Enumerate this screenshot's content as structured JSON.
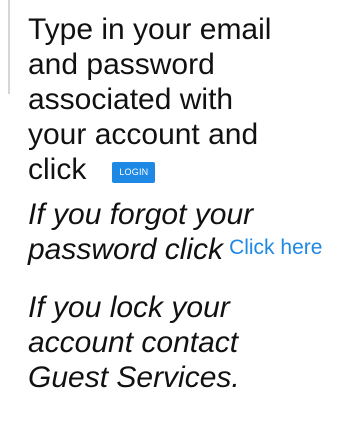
{
  "instructions": {
    "lines": [
      "Type in your email",
      "and password",
      "associated with",
      "your account and",
      "click"
    ],
    "login_button_label": "LOGIN"
  },
  "forgot": {
    "line1": "If you forgot your",
    "line2": "password click",
    "link_label": "Click here"
  },
  "lock": {
    "lines": [
      "If you lock your",
      "account contact",
      "Guest Services."
    ]
  },
  "colors": {
    "accent": "#1e88e5",
    "text": "#111111"
  }
}
